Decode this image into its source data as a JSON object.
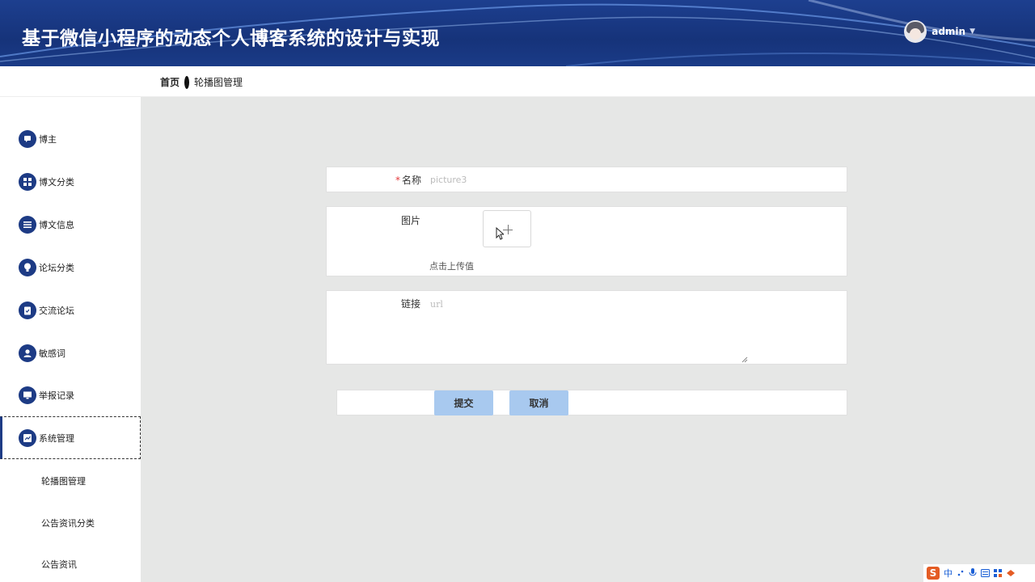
{
  "header": {
    "title": "基于微信小程序的动态个人博客系统的设计与实现",
    "username": "admin",
    "caret": "▼"
  },
  "breadcrumb": {
    "home": "首页",
    "current": "轮播图管理"
  },
  "sidebar": {
    "items": [
      {
        "label": "博主",
        "icon": "chat-icon"
      },
      {
        "label": "博文分类",
        "icon": "grid-icon"
      },
      {
        "label": "博文信息",
        "icon": "list-icon"
      },
      {
        "label": "论坛分类",
        "icon": "bulb-icon"
      },
      {
        "label": "交流论坛",
        "icon": "clipboard-icon"
      },
      {
        "label": "敏感词",
        "icon": "user-icon"
      },
      {
        "label": "举报记录",
        "icon": "monitor-icon"
      },
      {
        "label": "系统管理",
        "icon": "chart-icon",
        "active": true
      }
    ],
    "sub_items": [
      {
        "label": "轮播图管理"
      },
      {
        "label": "公告资讯分类"
      },
      {
        "label": "公告资讯"
      }
    ]
  },
  "form": {
    "name_label": "名称",
    "name_required": "*",
    "name_value": "picture3",
    "image_label": "图片",
    "image_hint": "点击上传值",
    "link_label": "链接",
    "link_value": "url"
  },
  "buttons": {
    "submit": "提交",
    "cancel": "取消"
  },
  "ime": {
    "logo": "S",
    "mode": "中"
  },
  "colors": {
    "header_bg": "#1d3f8f",
    "icon_bg": "#1d3b85",
    "button_bg": "#a8c9ef",
    "main_bg": "#e6e7e6"
  }
}
